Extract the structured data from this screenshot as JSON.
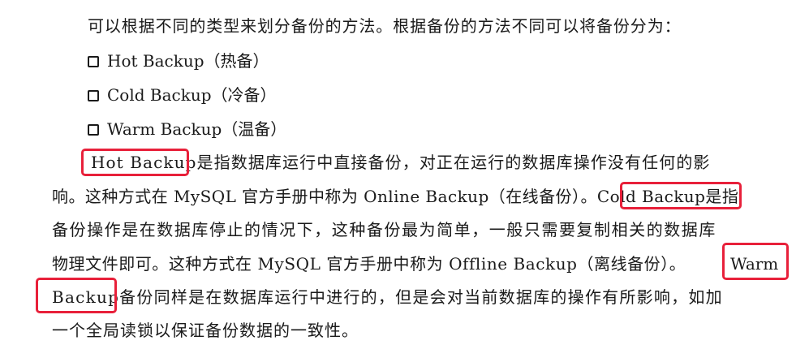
{
  "intro": "可以根据不同的类型来划分备份的方法。根据备份的方法不同可以将备份分为：",
  "bullets": [
    "Hot Backup（热备）",
    "Cold Backup（冷备）",
    "Warm Backup（温备）"
  ],
  "paragraph": {
    "hot_term": "Hot Backup",
    "line1_rest": "是指数据库运行中直接备份，对正在运行的数据库操作没有任何的影",
    "line2_text": "响。这种方式在 MySQL 官方手册中称为 Online Backup（在线备份）。",
    "cold_term": "Cold Backup",
    "line2_end": "是指",
    "line3_text": "备份操作是在数据库停止的情况下，这种备份最为简单，一般只需要复制相关的数据库",
    "line4_text": "物理文件即可。这种方式在 MySQL 官方手册中称为 Offline Backup（离线备份）。",
    "warm_term_part1": "Warm",
    "warm_term_part2": "Backup",
    "line5_rest": "备份同样是在数据库运行中进行的，但是会对当前数据库的操作有所影响，如加",
    "line6_text": "一个全局读锁以保证备份数据的一致性。"
  },
  "highlight_color": "#e8203a"
}
